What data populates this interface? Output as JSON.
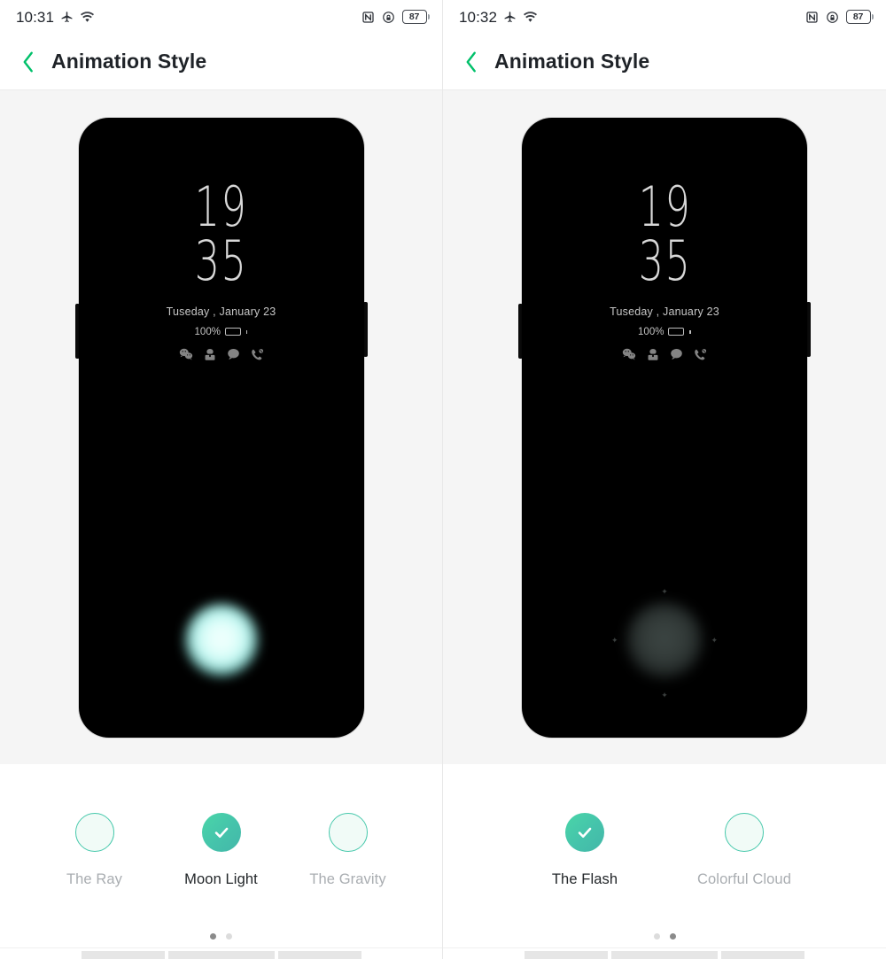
{
  "panels": [
    {
      "statusbar": {
        "time": "10:31",
        "icons": [
          "airplane-mode-icon",
          "wifi-icon",
          "nfc-icon",
          "alarm-lock-icon"
        ],
        "battery_level": "87"
      },
      "appbar": {
        "back_icon": "chevron-left-icon",
        "title": "Animation Style"
      },
      "preview": {
        "lockscreen": {
          "hours": "19",
          "minutes": "35",
          "date": "Tuseday , January 23",
          "battery_text": "100%",
          "notification_icons": [
            "wechat-icon",
            "contacts-icon",
            "message-bubble-icon",
            "missed-call-icon"
          ]
        },
        "effect": "moon-light-glow"
      },
      "options": [
        {
          "label": "The Ray",
          "selected": false
        },
        {
          "label": "Moon Light",
          "selected": true
        },
        {
          "label": "The Gravity",
          "selected": false
        }
      ],
      "pager": {
        "count": 2,
        "active": 1
      }
    },
    {
      "statusbar": {
        "time": "10:32",
        "icons": [
          "airplane-mode-icon",
          "wifi-icon",
          "nfc-icon",
          "alarm-lock-icon"
        ],
        "battery_level": "87"
      },
      "appbar": {
        "back_icon": "chevron-left-icon",
        "title": "Animation Style"
      },
      "preview": {
        "lockscreen": {
          "hours": "19",
          "minutes": "35",
          "date": "Tuseday , January 23",
          "battery_text": "100%",
          "notification_icons": [
            "wechat-icon",
            "contacts-icon",
            "message-bubble-icon",
            "missed-call-icon"
          ]
        },
        "effect": "the-flash-dim-glow"
      },
      "options": [
        {
          "label": "The Flash",
          "selected": true
        },
        {
          "label": "Colorful Cloud",
          "selected": false
        }
      ],
      "pager": {
        "count": 2,
        "active": 2
      }
    }
  ],
  "colors": {
    "accent_green": "#00c06a",
    "selected_teal": "#45c3ab",
    "ring_teal": "#46c8ab",
    "stage_bg": "#f5f5f5",
    "title_text": "#1f2328",
    "unselected_text": "#a9adb1"
  }
}
